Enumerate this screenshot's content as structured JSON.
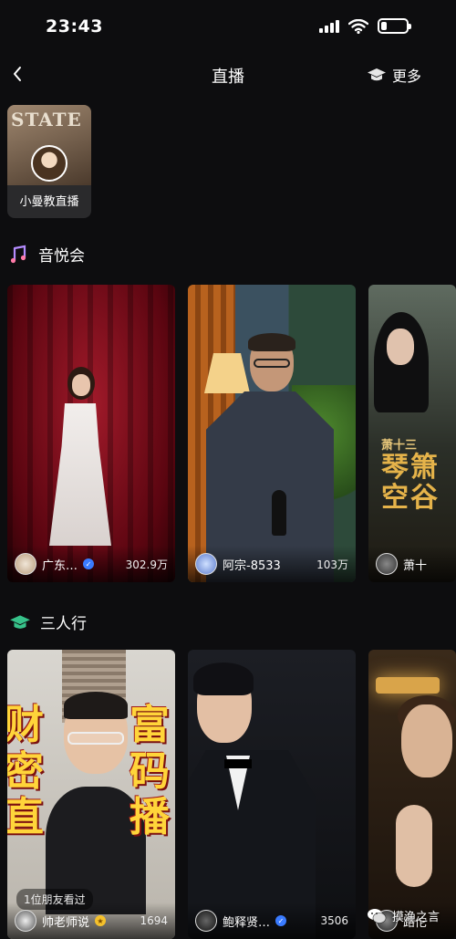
{
  "status_bar": {
    "time": "23:43"
  },
  "nav": {
    "title": "直播",
    "more_label": "更多"
  },
  "featured": [
    {
      "label": "小曼教直播",
      "thumb_text": "STATE"
    }
  ],
  "sections": [
    {
      "title": "音悦会",
      "icon": "music-note-icon",
      "cards": [
        {
          "user": "广东…",
          "views": "302.9万",
          "verified": true
        },
        {
          "user": "阿宗-8533",
          "views": "103万",
          "verified": false
        },
        {
          "user": "萧十",
          "views": "",
          "verified": false,
          "poster_lines": [
            "萧十三",
            "琴箫",
            "空谷"
          ],
          "poster_small": "音"
        }
      ]
    },
    {
      "title": "三人行",
      "icon": "graduation-cap-icon",
      "cards": [
        {
          "user": "帅老师说",
          "views": "1694",
          "verified": true,
          "friend_note": "1位朋友看过",
          "left_text": "财密直",
          "right_text": "富码播"
        },
        {
          "user": "鲍释贤…",
          "views": "3506",
          "verified": true
        },
        {
          "user": "路佗",
          "views": "",
          "verified": false
        }
      ]
    }
  ],
  "watermark": {
    "text": "摸渔之言"
  },
  "colors": {
    "background": "#0d0d0f",
    "verified_badge": "#3a7bff",
    "gold_badge": "#f5c12b",
    "poster_text": "#e5b34a",
    "promo_text": "#ffd53a"
  }
}
